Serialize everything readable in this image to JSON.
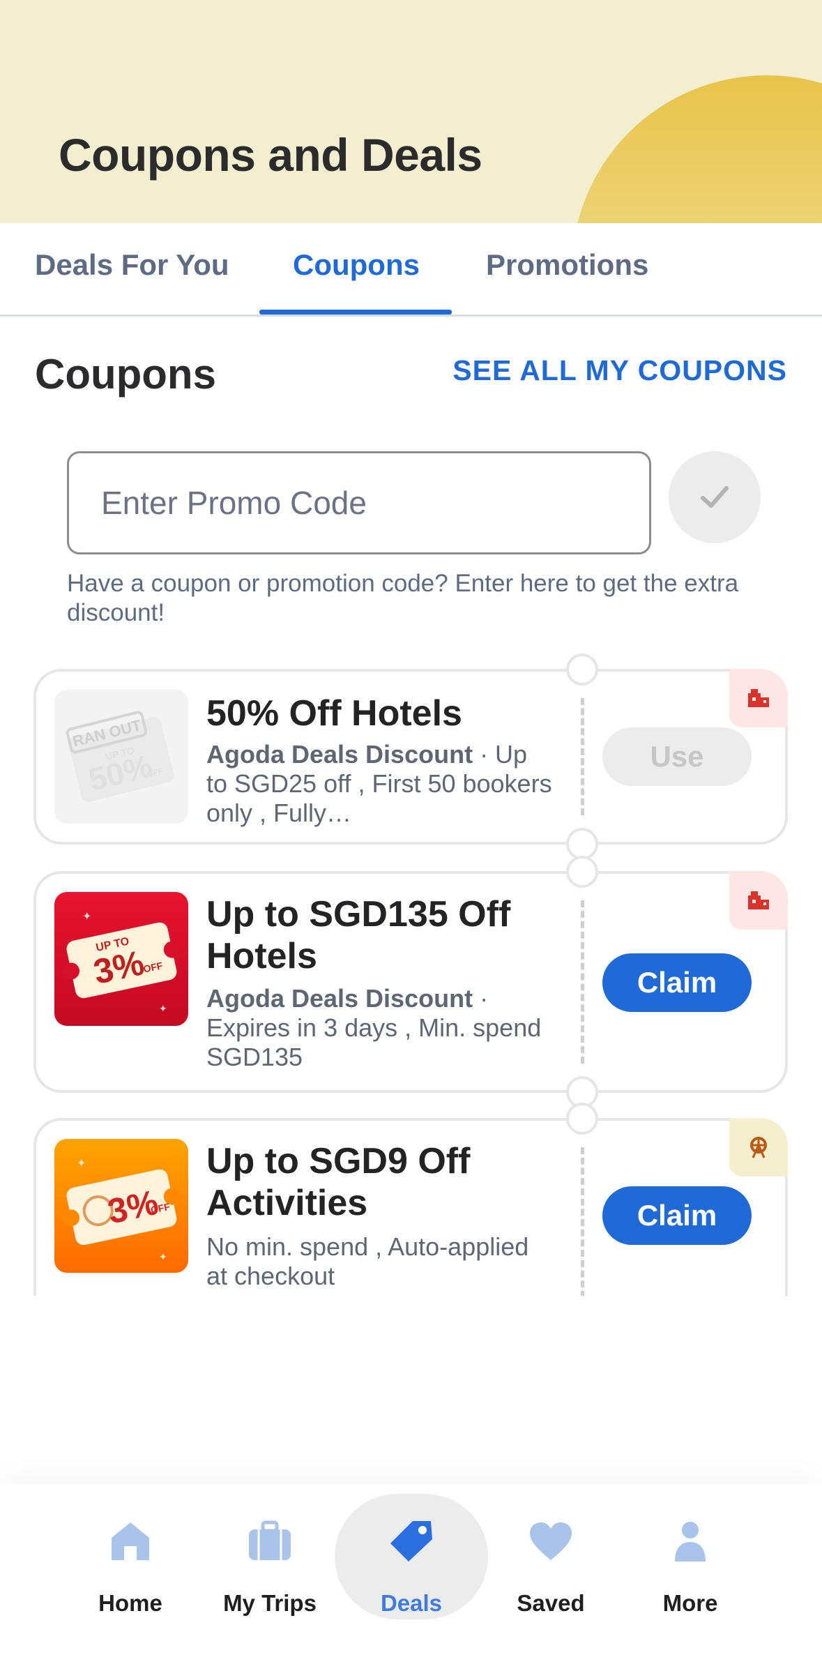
{
  "header": {
    "title": "Coupons and Deals"
  },
  "tabs": [
    {
      "label": "Deals For You",
      "active": false
    },
    {
      "label": "Coupons",
      "active": true
    },
    {
      "label": "Promotions",
      "active": false
    }
  ],
  "coupons_section": {
    "title": "Coupons",
    "see_all": "SEE ALL MY COUPONS",
    "promo_placeholder": "Enter Promo Code",
    "promo_hint": "Have a coupon or promotion code? Enter here to get the extra discount!"
  },
  "coupons": [
    {
      "title": "50% Off Hotels",
      "provider": "Agoda Deals Discount",
      "details": " · Up to SGD25 off , First 50 bookers only , Fully…",
      "button": "Use",
      "state": "ran-out",
      "thumb_text": {
        "status": "RAN OUT",
        "up_to": "UP TO",
        "value": "50%",
        "off": "OFF"
      },
      "category_icon": "hotel-icon"
    },
    {
      "title": "Up to SGD135 Off Hotels",
      "provider": "Agoda Deals Discount",
      "details": " · Expires in 3 days , Min. spend SGD135",
      "button": "Claim",
      "state": "available",
      "thumb_text": {
        "up_to": "UP TO",
        "value": "3%",
        "off": "OFF"
      },
      "category_icon": "hotel-icon"
    },
    {
      "title": "Up to SGD9 Off Activities",
      "provider": "",
      "details": "No min. spend , Auto-applied at checkout",
      "button": "Claim",
      "state": "available",
      "thumb_text": {
        "value": "3%",
        "off": "OFF"
      },
      "category_icon": "ferris-wheel-icon"
    }
  ],
  "bottom_nav": [
    {
      "label": "Home",
      "icon": "home-icon",
      "active": false
    },
    {
      "label": "My Trips",
      "icon": "suitcase-icon",
      "active": false
    },
    {
      "label": "Deals",
      "icon": "tag-icon",
      "active": true
    },
    {
      "label": "Saved",
      "icon": "heart-icon",
      "active": false
    },
    {
      "label": "More",
      "icon": "person-icon",
      "active": false
    }
  ],
  "colors": {
    "primary": "#1f6ad6",
    "header_bg": "#f2efd0",
    "sun": "#e8c44a",
    "hotel_badge": "#fde6e4",
    "activity_badge": "#f6efcf",
    "red_thumb": "#d8102c",
    "orange_thumb": "#ff8a00"
  }
}
